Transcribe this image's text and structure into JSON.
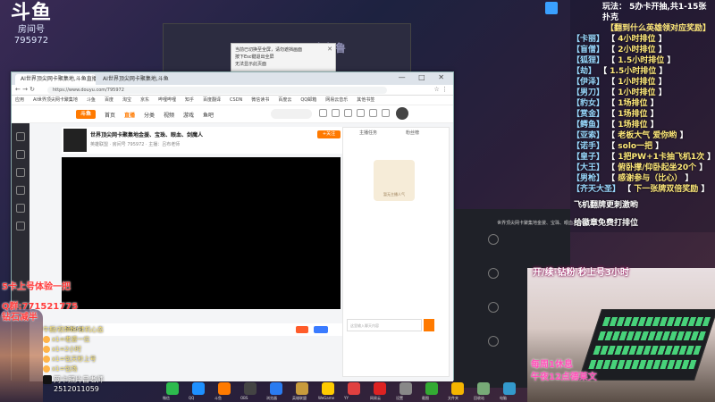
{
  "overlay": {
    "logo": {
      "brand": "斗鱼",
      "label": "房间号",
      "room_id": "795972"
    },
    "alert": {
      "line1": "当前已切换至全屏，请勿遮挡画面",
      "line2": "按下Esc键退出全屏",
      "line3": "无法显示此页面"
    },
    "background_sign": "乌鲁鲁"
  },
  "rules": {
    "head1": "玩法：  5办卡开抽,共1-15张扑克",
    "head2": "【翻到什么英雄领对应奖励】",
    "ranks": [
      {
        "name": "【卡丽】",
        "sep": "【",
        "val": "4小时排位",
        "end": "】"
      },
      {
        "name": "【盲僧】",
        "sep": "【",
        "val": "2小时排位",
        "end": "】"
      },
      {
        "name": "【狐狸】",
        "sep": "【",
        "val": "1.5小时排位",
        "end": "】"
      },
      {
        "name": "【劫】",
        "sep": "【",
        "val": "1.5小时排位",
        "end": "】"
      },
      {
        "name": "【伊泽】",
        "sep": "【",
        "val": "1小时排位",
        "end": "】"
      },
      {
        "name": "【男刀】",
        "sep": "【",
        "val": "1小时排位",
        "end": "】"
      },
      {
        "name": "【豹女】",
        "sep": "【",
        "val": "1场排位",
        "end": "】"
      },
      {
        "name": "【赏金】",
        "sep": "【",
        "val": "1场排位",
        "end": "】"
      },
      {
        "name": "【鳄鱼】",
        "sep": "【",
        "val": "1场排位",
        "end": "】"
      },
      {
        "name": "【亚索】",
        "sep": "【",
        "val": "老板大气 爱你哟",
        "end": "】"
      },
      {
        "name": "【诺手】",
        "sep": "【",
        "val": "solo一把",
        "end": "】"
      },
      {
        "name": "【皇子】",
        "sep": "【",
        "val": "1把PW+1卡抽飞机1次",
        "end": "】"
      },
      {
        "name": "【大王】",
        "sep": "【",
        "val": "俯卧撑/仰卧起坐20个",
        "end": "】"
      },
      {
        "name": "【男枪】",
        "sep": "【",
        "val": "感谢参与（比心）",
        "end": "】"
      },
      {
        "name": "【齐天大圣】",
        "sep": "【",
        "val": "下一张牌双倍奖励",
        "end": "】"
      }
    ],
    "note1": "飞机翻牌更刺激哟",
    "note2": "给徽章免费打排位"
  },
  "browser": {
    "tabs": [
      "AI世界顶尖网卡聚集地,斗鱼直播间",
      "AI世界顶尖网卡聚集地,斗鱼"
    ],
    "window_controls": "—  □  ✕",
    "address": "https://www.douyu.com/795972",
    "bookmarks": [
      "应用",
      "AI世界顶尖网卡聚集地",
      "斗鱼",
      "百度",
      "淘宝",
      "京东",
      "哔哩哔哩",
      "知乎",
      "百度翻译",
      "CSDN",
      "微信读书",
      "百度云",
      "QQ邮箱",
      "网易云音乐",
      "其他书签"
    ],
    "site_logo": "斗鱼",
    "nav": [
      "首页",
      "直播",
      "分类",
      "视频",
      "游戏",
      "鱼吧"
    ],
    "room": {
      "title": "世界顶尖网卡聚集地金援、宝珠、眼血、剑魔人",
      "meta": "英雄联盟  ·  房间号 795972  ·  主播：吕布老师",
      "follow": "+关注"
    },
    "under_video": "弹幕设置",
    "chat": {
      "tab1": "主播任务",
      "tab2": "粉丝榜",
      "image_caption": "暂无主播人气",
      "input_placeholder": "这里输入聊天内容"
    }
  },
  "obs": {
    "title": "世界顶尖网卡聚集地金援、宝珠、眼血、剑魔人"
  },
  "cam": {
    "top": "开/续·钻粉 秒上号3小时",
    "sched1": "每周1休息",
    "sched2": "午夜12点德莱文"
  },
  "left": {
    "promo1": "5卡上号体验一把",
    "promo2": "Q群:771521775",
    "promo3": "钻石减半",
    "gift_header": "牛橱/视频粉/挂机心态",
    "gifts": [
      "x1=老婆一位",
      "x1=2小时",
      "x1=包天秒上号",
      "x1=包场"
    ],
    "douyin_name": "网卡照片吕老师",
    "douyin_id": "2512011059"
  },
  "taskbar": [
    "微信",
    "QQ",
    "斗鱼",
    "OBS",
    "浏览器",
    "英雄联盟",
    "WeGame",
    "YY",
    "网易云",
    "设置",
    "截图",
    "文件夹",
    "回收站",
    "电脑"
  ],
  "colors": {
    "brand": "#ff7a00",
    "promo_red": "#ff3b3b",
    "gold": "#ffe97a",
    "cam_pink": "#ff4fb8"
  }
}
